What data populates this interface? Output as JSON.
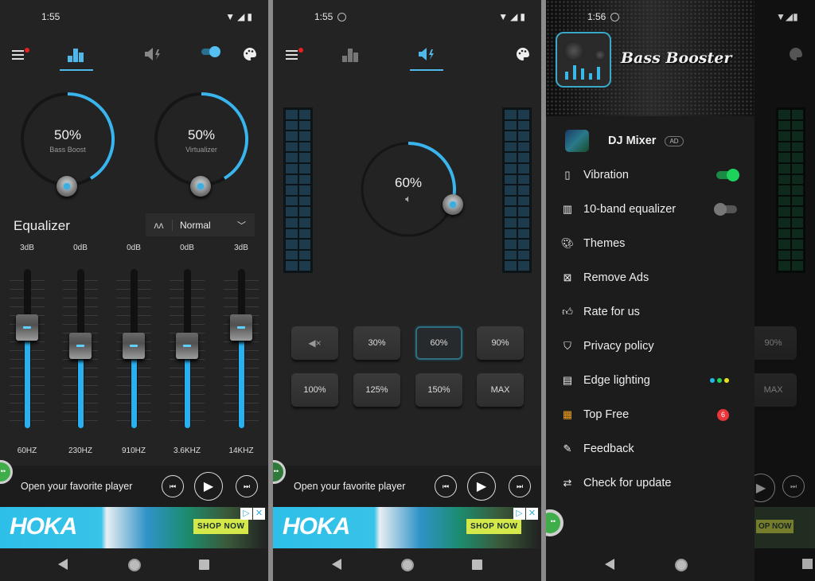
{
  "colors": {
    "accent": "#29b0ef",
    "toggle_on": "#1ed35c",
    "badge": "#e9363b"
  },
  "screen1": {
    "status": {
      "time": "1:55"
    },
    "toolbar": {
      "active_tab": "equalizer",
      "tabs": [
        "menu-icon",
        "equalizer-icon",
        "volume-boost-icon",
        "power-toggle",
        "theme-icon"
      ]
    },
    "bass_boost": {
      "value": "50%",
      "label": "Bass Boost",
      "fraction": 0.5
    },
    "virtualizer": {
      "value": "50%",
      "label": "Virtualizer",
      "fraction": 0.5
    },
    "equalizer": {
      "title": "Equalizer",
      "preset": "Normal",
      "bands": [
        {
          "gain": "3dB",
          "freq": "60HZ",
          "level": 0.6
        },
        {
          "gain": "0dB",
          "freq": "230HZ",
          "level": 0.5
        },
        {
          "gain": "0dB",
          "freq": "910HZ",
          "level": 0.5
        },
        {
          "gain": "0dB",
          "freq": "3.6KHZ",
          "level": 0.5
        },
        {
          "gain": "3dB",
          "freq": "14KHZ",
          "level": 0.6
        }
      ]
    },
    "player": {
      "text": "Open your favorite player"
    },
    "ad": {
      "brand": "HOKA",
      "cta": "SHOP NOW"
    }
  },
  "screen2": {
    "status": {
      "time": "1:55"
    },
    "volume": {
      "value": "60%",
      "fraction": 0.6
    },
    "buttons": [
      {
        "label": "mute"
      },
      {
        "label": "30%"
      },
      {
        "label": "60%",
        "selected": true
      },
      {
        "label": "90%"
      },
      {
        "label": "100%"
      },
      {
        "label": "125%"
      },
      {
        "label": "150%"
      },
      {
        "label": "MAX"
      }
    ],
    "player": {
      "text": "Open your favorite player"
    },
    "ad": {
      "brand": "HOKA",
      "cta": "SHOP NOW"
    }
  },
  "screen3": {
    "status": {
      "time": "1:56"
    },
    "app_name": "Bass Booster",
    "promo": {
      "name": "DJ Mixer",
      "badge": "AD"
    },
    "menu": [
      {
        "label": "Vibration",
        "icon": "vibration-icon",
        "toggle": true
      },
      {
        "label": "10-band equalizer",
        "icon": "equalizer-bars-icon",
        "toggle": false
      },
      {
        "label": "Themes",
        "icon": "palette-icon"
      },
      {
        "label": "Remove Ads",
        "icon": "remove-ads-icon"
      },
      {
        "label": "Rate for us",
        "icon": "thumbs-up-icon"
      },
      {
        "label": "Privacy policy",
        "icon": "shield-check-icon"
      },
      {
        "label": "Edge lighting",
        "icon": "edge-lighting-icon",
        "dots": [
          "#22b8e8",
          "#22d45a",
          "#e8e020"
        ]
      },
      {
        "label": "Top Free",
        "icon": "top-free-icon",
        "badge": "6"
      },
      {
        "label": "Feedback",
        "icon": "feedback-icon"
      },
      {
        "label": "Check for update",
        "icon": "refresh-icon"
      }
    ],
    "background_buttons": [
      "90%",
      "MAX"
    ],
    "ad": {
      "cta": "OP NOW"
    }
  }
}
